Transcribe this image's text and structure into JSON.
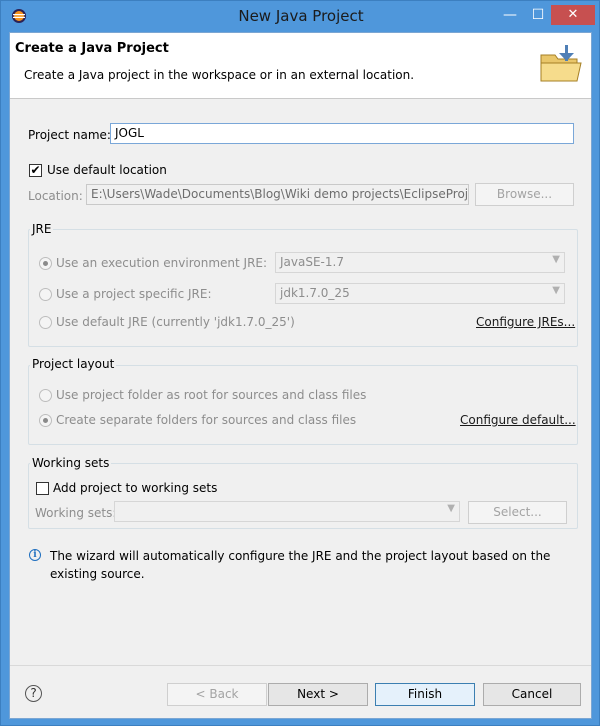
{
  "window": {
    "title": "New Java Project",
    "minimize": "—",
    "maximize": "☐",
    "close": "✕"
  },
  "banner": {
    "title": "Create a Java Project",
    "subtitle": "Create a Java project in the workspace or in an external location."
  },
  "project": {
    "name_label": "Project name:",
    "name_value": "JOGL",
    "use_default_location_label": "Use default location",
    "use_default_location_checked": true,
    "location_label": "Location:",
    "location_value": "E:\\Users\\Wade\\Documents\\Blog\\Wiki demo projects\\EclipseProjects\\",
    "browse_label": "Browse..."
  },
  "jre": {
    "group_title": "JRE",
    "option_env_label": "Use an execution environment JRE:",
    "option_env_value": "JavaSE-1.7",
    "option_specific_label": "Use a project specific JRE:",
    "option_specific_value": "jdk1.7.0_25",
    "option_default_label": "Use default JRE (currently 'jdk1.7.0_25')",
    "configure_link": "Configure JREs..."
  },
  "layout": {
    "group_title": "Project layout",
    "option_root_label": "Use project folder as root for sources and class files",
    "option_separate_label": "Create separate folders for sources and class files",
    "configure_link": "Configure default..."
  },
  "working_sets": {
    "group_title": "Working sets",
    "add_label": "Add project to working sets",
    "sets_label": "Working sets:",
    "sets_value": "",
    "select_label": "Select..."
  },
  "info": {
    "text": "The wizard will automatically configure the JRE and the project layout based on the existing source."
  },
  "footer": {
    "help": "?",
    "back_label": "< Back",
    "next_label": "Next >",
    "finish_label": "Finish",
    "cancel_label": "Cancel"
  }
}
